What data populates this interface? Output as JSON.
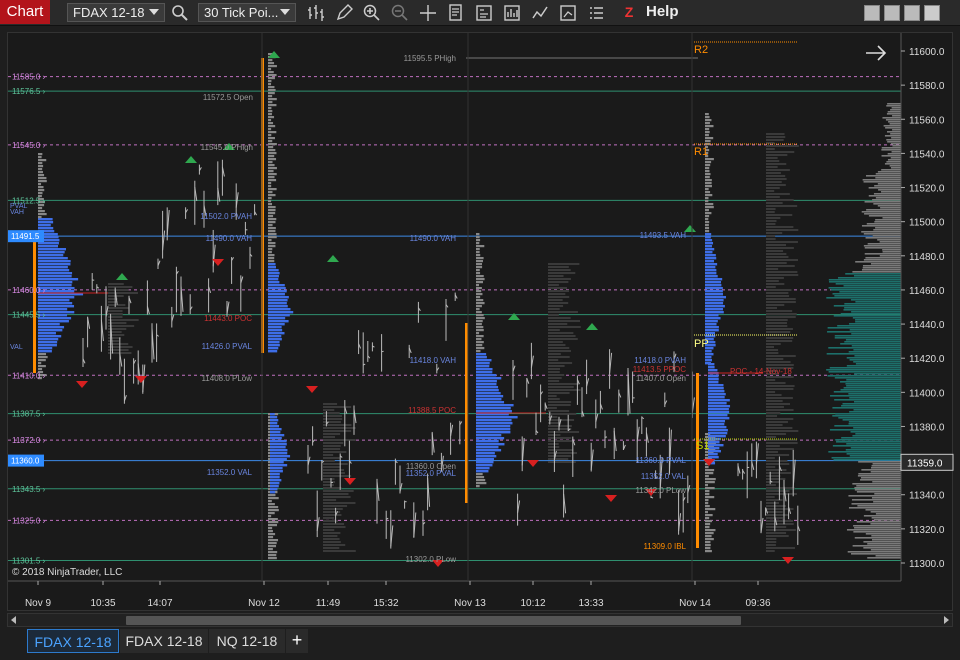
{
  "toolbar": {
    "chart_label": "Chart",
    "instrument": "FDAX 12-18",
    "bar_type": "30 Tick Poi...",
    "help_label": "Help",
    "help_z": "Z"
  },
  "chart": {
    "copyright": "© 2018 NinjaTrader, LLC",
    "last_price": "11359.0",
    "price_ticks": [
      "11600.0",
      "11580.0",
      "11560.0",
      "11540.0",
      "11520.0",
      "11500.0",
      "11480.0",
      "11460.0",
      "11440.0",
      "11420.0",
      "11400.0",
      "11380.0",
      "11360.0",
      "11340.0",
      "11320.0",
      "11300.0"
    ],
    "time_ticks": [
      "Nov 9",
      "10:35",
      "14:07",
      "Nov 12",
      "11:49",
      "15:32",
      "Nov 13",
      "10:12",
      "13:33",
      "Nov 14",
      "09:36"
    ],
    "left_labels": [
      "11585.0",
      "11576.5",
      "11545.0",
      "11512.5",
      "11491.5",
      "11460.0",
      "11445.5",
      "11410.0",
      "11387.5",
      "11372.0",
      "11360.0",
      "11343.5",
      "11325.0",
      "11301.5"
    ],
    "left_label_tags": [
      "VAH",
      "PVAL",
      "VAL"
    ],
    "annotations": {
      "phigh": "11595.5 PHigh",
      "open_1": "11572.5 Open",
      "phigh_2": "11545.0 PHigh",
      "pvah_1": "11502.0 PVAH",
      "vah_1": "11490.0 VAH",
      "vah_2": "11490.0 VAH",
      "poc_1": "11443.0 POC",
      "val_1": "11426.0 PVAL",
      "plow_1": "11408.0 PLow",
      "val_2": "11352.0 VAL",
      "vah_3": "11418.0 VAH",
      "poc_2": "11388.5 POC",
      "open_2": "11360.0 Open",
      "pval_2": "11352.0 PVAL",
      "plow_2": "11302.0 PLow",
      "vah_4": "11493.5 VAH",
      "pvah_2": "11418.0 PVAH",
      "ppoc": "11413.5 PPOC",
      "open_3": "11407.0 Open",
      "pval_3": "11360.0 PVAL",
      "val_3": "11352.0 VAL",
      "plow_3": "11342.0 PLow",
      "ibl": "11309.0 IBL",
      "poc_nov14": "POC - 14-Nov-18",
      "r2": "R2",
      "r1": "R1",
      "pp": "PP",
      "s1": "S1"
    }
  },
  "tabs": [
    "FDAX 12-18",
    "FDAX 12-18",
    "NQ 12-18"
  ],
  "tab_add": "+",
  "colors": {
    "accent": "#b3141b",
    "vah_blue": "#3e6ee8",
    "poc_red": "#cc2222",
    "green_line": "#2f8f6f",
    "pink_dash": "#c070c0",
    "orange": "#ff8c00",
    "last_price_bg": "#2a2a2a"
  }
}
